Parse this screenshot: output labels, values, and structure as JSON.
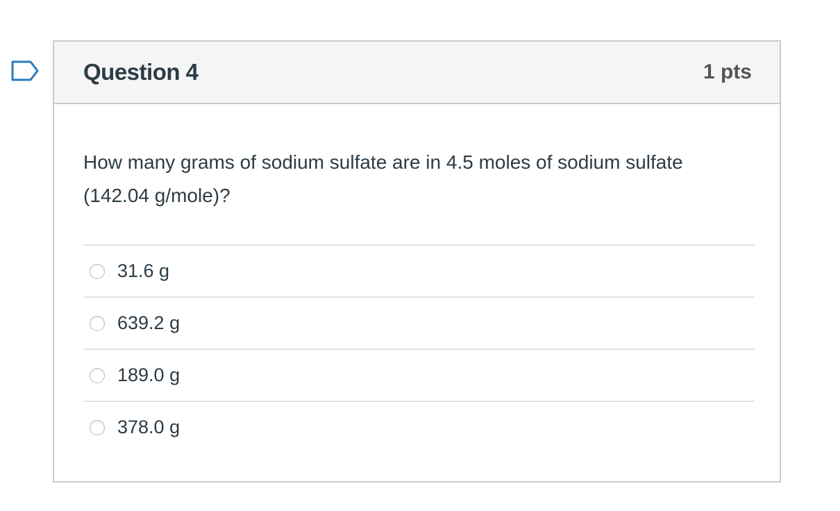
{
  "question": {
    "title": "Question 4",
    "points": "1 pts",
    "text": "How many grams of sodium sulfate are in 4.5 moles of sodium sulfate (142.04 g/mole)?",
    "flag_icon": "flag-bookmark-icon",
    "accent_color": "#2b7abc"
  },
  "answers": [
    {
      "label": "31.6 g",
      "selected": false
    },
    {
      "label": "639.2 g",
      "selected": false
    },
    {
      "label": "189.0 g",
      "selected": false
    },
    {
      "label": "378.0 g",
      "selected": false
    }
  ]
}
